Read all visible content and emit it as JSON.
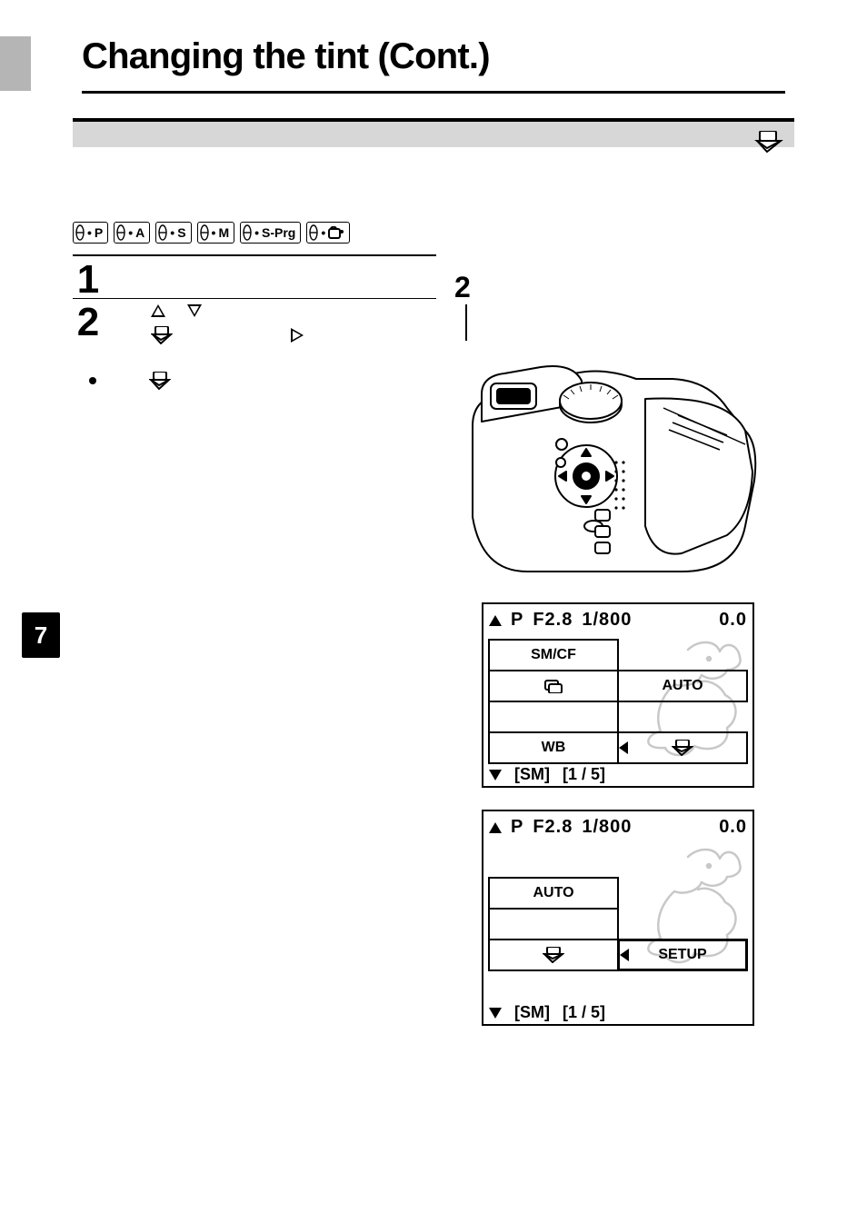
{
  "header": {
    "title": "Changing the tint (Cont.)"
  },
  "chapter": {
    "number": "7"
  },
  "modes": {
    "items": [
      {
        "label": "P"
      },
      {
        "label": "A"
      },
      {
        "label": "S"
      },
      {
        "label": "M"
      },
      {
        "label": "S-Prg"
      },
      {
        "label": "My",
        "icon": "my-mode"
      }
    ]
  },
  "steps": {
    "s1": {
      "num": "1"
    },
    "s2": {
      "num": "2"
    }
  },
  "diagram": {
    "callout": "2"
  },
  "lcd1": {
    "top": {
      "mode": "P",
      "fnum": "F2.8",
      "shutter": "1/800",
      "ev": "0.0"
    },
    "cells": {
      "c1": "SM/CF",
      "c2": "",
      "c3_icon": "print-stack",
      "c4": "AUTO",
      "c5": "",
      "c6": "",
      "c7": "WB",
      "c8_icon": "card-over-stack"
    },
    "foot": {
      "media": "SM",
      "page": "1 / 5"
    }
  },
  "lcd2": {
    "top": {
      "mode": "P",
      "fnum": "F2.8",
      "shutter": "1/800",
      "ev": "0.0"
    },
    "cells": {
      "c1": "AUTO",
      "c3_icon": "card-over-stack",
      "c4": "SETUP"
    },
    "foot": {
      "media": "SM",
      "page": "1 / 5"
    }
  }
}
